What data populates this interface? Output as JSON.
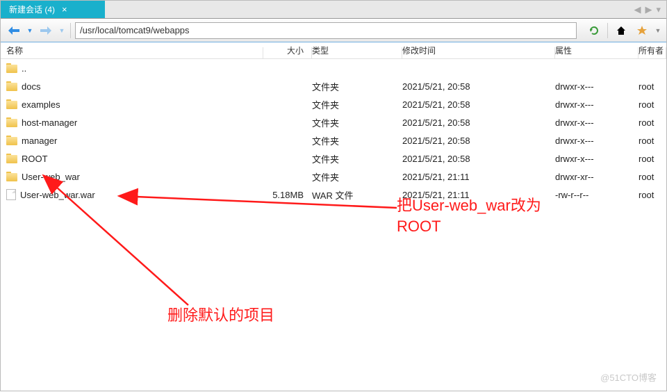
{
  "tab": {
    "title": "新建会话 (4)"
  },
  "toolbar": {
    "path": "/usr/local/tomcat9/webapps"
  },
  "columns": {
    "name": "名称",
    "size": "大小",
    "type": "类型",
    "date": "修改时间",
    "attr": "属性",
    "owner": "所有者"
  },
  "rows": [
    {
      "icon": "folder",
      "name": "..",
      "size": "",
      "type": "",
      "date": "",
      "attr": "",
      "owner": ""
    },
    {
      "icon": "folder",
      "name": "docs",
      "size": "",
      "type": "文件夹",
      "date": "2021/5/21, 20:58",
      "attr": "drwxr-x---",
      "owner": "root"
    },
    {
      "icon": "folder",
      "name": "examples",
      "size": "",
      "type": "文件夹",
      "date": "2021/5/21, 20:58",
      "attr": "drwxr-x---",
      "owner": "root"
    },
    {
      "icon": "folder",
      "name": "host-manager",
      "size": "",
      "type": "文件夹",
      "date": "2021/5/21, 20:58",
      "attr": "drwxr-x---",
      "owner": "root"
    },
    {
      "icon": "folder",
      "name": "manager",
      "size": "",
      "type": "文件夹",
      "date": "2021/5/21, 20:58",
      "attr": "drwxr-x---",
      "owner": "root"
    },
    {
      "icon": "folder",
      "name": "ROOT",
      "size": "",
      "type": "文件夹",
      "date": "2021/5/21, 20:58",
      "attr": "drwxr-x---",
      "owner": "root"
    },
    {
      "icon": "folder",
      "name": "User-web_war",
      "size": "",
      "type": "文件夹",
      "date": "2021/5/21, 21:11",
      "attr": "drwxr-xr--",
      "owner": "root"
    },
    {
      "icon": "file",
      "name": "User-web_war.war",
      "size": "5.18MB",
      "type": "WAR 文件",
      "date": "2021/5/21, 21:11",
      "attr": "-rw-r--r--",
      "owner": "root"
    }
  ],
  "annotations": {
    "rename": "把User-web_war改为\nROOT",
    "delete": "删除默认的项目"
  },
  "watermark": "@51CTO博客"
}
